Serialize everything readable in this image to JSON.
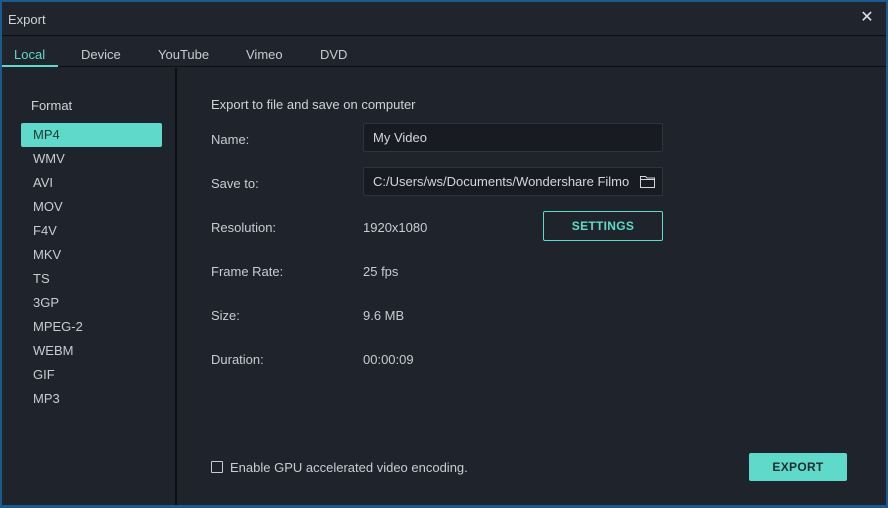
{
  "window": {
    "title": "Export",
    "close_glyph": "✕"
  },
  "tabs": [
    {
      "label": "Local",
      "active": true
    },
    {
      "label": "Device",
      "active": false
    },
    {
      "label": "YouTube",
      "active": false
    },
    {
      "label": "Vimeo",
      "active": false
    },
    {
      "label": "DVD",
      "active": false
    }
  ],
  "sidebar": {
    "heading": "Format",
    "selected": "MP4",
    "formats": [
      "MP4",
      "WMV",
      "AVI",
      "MOV",
      "F4V",
      "MKV",
      "TS",
      "3GP",
      "MPEG-2",
      "WEBM",
      "GIF",
      "MP3"
    ]
  },
  "main": {
    "heading": "Export to file and save on computer",
    "name": {
      "label": "Name:",
      "value": "My Video"
    },
    "save_to": {
      "label": "Save to:",
      "value": "C:/Users/ws/Documents/Wondershare Filmo",
      "icon": "folder-icon"
    },
    "resolution": {
      "label": "Resolution:",
      "value": "1920x1080"
    },
    "settings_label": "SETTINGS",
    "frame_rate": {
      "label": "Frame Rate:",
      "value": "25 fps"
    },
    "size": {
      "label": "Size:",
      "value": "9.6 MB"
    },
    "duration": {
      "label": "Duration:",
      "value": "00:00:09"
    },
    "gpu": {
      "label": "Enable GPU accelerated video encoding.",
      "checked": false
    },
    "export_label": "EXPORT"
  },
  "colors": {
    "accent": "#5fd9c9",
    "background": "#1f232b",
    "window_border": "#1b5a8c"
  }
}
